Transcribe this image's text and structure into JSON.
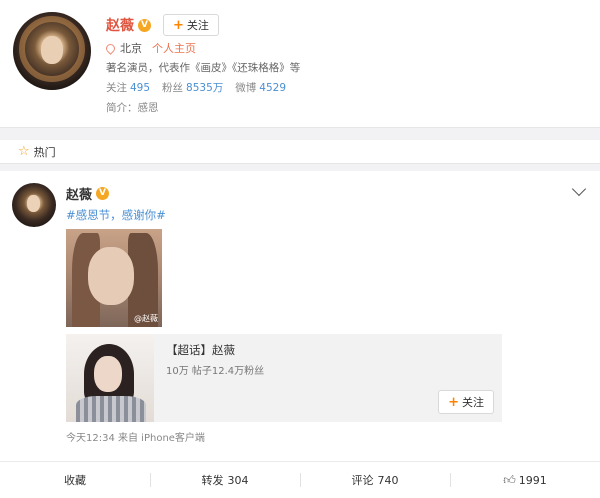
{
  "profile": {
    "name": "赵薇",
    "verified_badge": "V",
    "follow_label": "关注",
    "location": "北京",
    "homepage_label": "个人主页",
    "description": "著名演员，代表作《画皮》《还珠格格》等",
    "stats": [
      {
        "label": "关注",
        "value": "495"
      },
      {
        "label": "粉丝",
        "value": "8535万"
      },
      {
        "label": "微博",
        "value": "4529"
      }
    ],
    "bio": "简介：感恩"
  },
  "hot": {
    "icon": "star-icon",
    "label": "热门"
  },
  "post": {
    "author": "赵薇",
    "verified_badge": "V",
    "hashtag": "#感恩节，感谢你#",
    "photo_watermark": "@赵薇",
    "topic": {
      "title": "【超话】赵薇",
      "subtitle": "10万 帖子12.4万粉丝",
      "follow_label": "关注"
    },
    "meta": "今天12:34 来自 iPhone客户端"
  },
  "actions": {
    "favorite": {
      "label": "收藏"
    },
    "repost": {
      "label": "转发",
      "count": "304"
    },
    "comment": {
      "label": "评论",
      "count": "740"
    },
    "like": {
      "count": "1991"
    }
  },
  "colors": {
    "accent": "#ff8200",
    "link": "#4a8fd4",
    "name": "#e0553f"
  }
}
